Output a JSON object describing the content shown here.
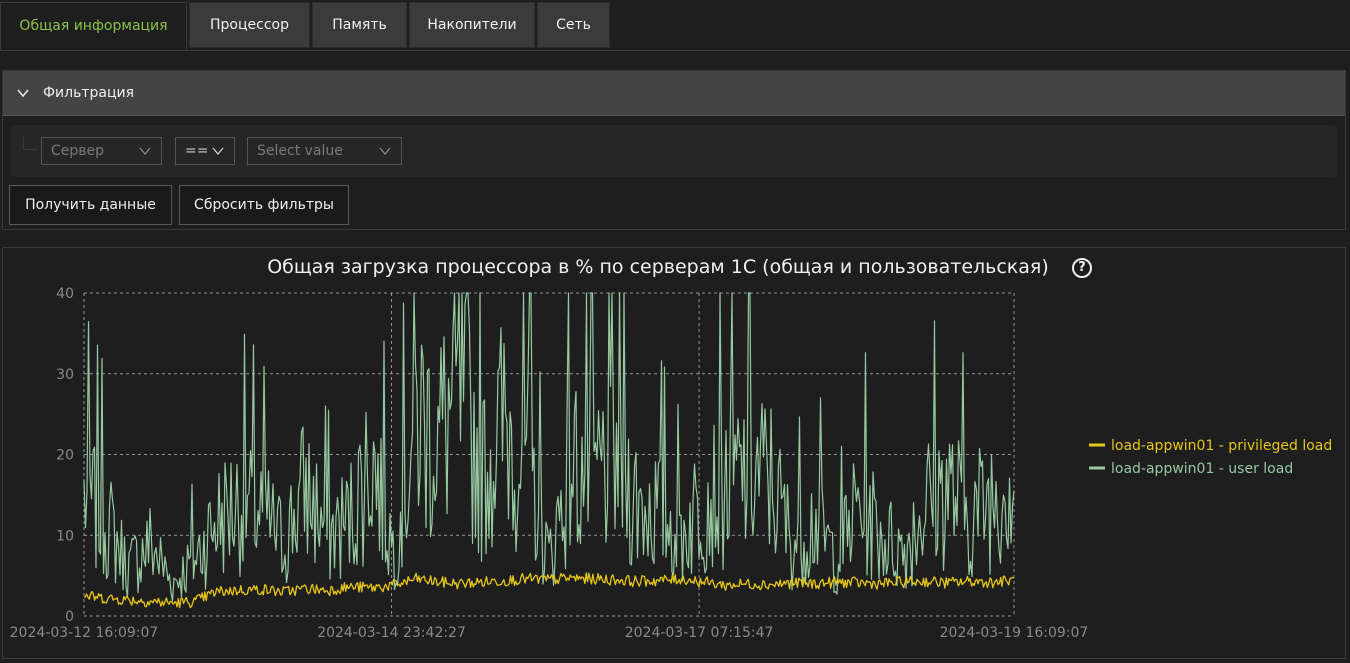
{
  "tabs": [
    {
      "label": "Общая информация",
      "active": true
    },
    {
      "label": "Процессор",
      "active": false
    },
    {
      "label": "Память",
      "active": false
    },
    {
      "label": "Накопители",
      "active": false
    },
    {
      "label": "Сеть",
      "active": false
    }
  ],
  "filter": {
    "title": "Фильтрация",
    "field_value": "Сервер",
    "operator_value": "==",
    "value_placeholder": "Select value",
    "get_data_label": "Получить данные",
    "reset_label": "Сбросить фильтры"
  },
  "colors": {
    "accent": "#8bc34a",
    "privileged": "#e6c619",
    "user": "#97c9a0"
  },
  "chart_data": {
    "type": "line",
    "title": "Общая загрузка процессора в % по серверам 1С (общая и пользовательская)",
    "help_icon": "question-circle-icon",
    "ylim": [
      0,
      40
    ],
    "yticks": [
      0,
      10,
      20,
      30,
      40
    ],
    "xlim": [
      "2024-03-12 16:09:07",
      "2024-03-19 16:09:07"
    ],
    "xticks": [
      "2024-03-12 16:09:07",
      "2024-03-14 23:42:27",
      "2024-03-17 07:15:47",
      "2024-03-19 16:09:07"
    ],
    "grid": true,
    "legend_position": "right",
    "series": [
      {
        "name": "load-appwin01 - privileged load",
        "color": "#e6c619",
        "x": [
          "2024-03-12 16:09",
          "2024-03-12 20:09",
          "2024-03-13 00:09",
          "2024-03-13 04:09",
          "2024-03-13 08:09",
          "2024-03-13 12:09",
          "2024-03-13 16:09",
          "2024-03-13 20:09",
          "2024-03-14 00:09",
          "2024-03-14 04:09",
          "2024-03-14 08:09",
          "2024-03-14 12:09",
          "2024-03-14 16:09",
          "2024-03-14 20:09",
          "2024-03-15 00:09",
          "2024-03-15 04:09",
          "2024-03-15 08:09",
          "2024-03-15 12:09",
          "2024-03-15 16:09",
          "2024-03-15 20:09",
          "2024-03-16 00:09",
          "2024-03-16 04:09",
          "2024-03-16 08:09",
          "2024-03-16 12:09",
          "2024-03-16 16:09",
          "2024-03-16 20:09",
          "2024-03-17 00:09",
          "2024-03-17 04:09",
          "2024-03-17 08:09",
          "2024-03-17 12:09",
          "2024-03-17 16:09",
          "2024-03-17 20:09",
          "2024-03-18 00:09",
          "2024-03-18 04:09",
          "2024-03-18 08:09",
          "2024-03-18 12:09",
          "2024-03-18 16:09",
          "2024-03-18 20:09",
          "2024-03-19 00:09",
          "2024-03-19 04:09",
          "2024-03-19 08:09",
          "2024-03-19 12:09",
          "2024-03-19 16:09"
        ],
        "values": [
          2.5,
          2.2,
          2.0,
          1.8,
          1.6,
          1.8,
          3.0,
          3.2,
          3.3,
          3.0,
          3.4,
          3.2,
          3.6,
          3.5,
          3.8,
          4.6,
          4.2,
          4.0,
          4.2,
          4.4,
          4.6,
          4.5,
          4.7,
          4.6,
          4.5,
          4.3,
          4.4,
          4.6,
          4.2,
          3.8,
          4.0,
          3.9,
          4.1,
          4.0,
          4.2,
          4.1,
          4.0,
          4.2,
          4.3,
          4.1,
          4.3,
          4.2,
          4.4
        ]
      },
      {
        "name": "load-appwin01 - user load",
        "color": "#97c9a0",
        "x": [
          "2024-03-12 16:09",
          "2024-03-12 20:09",
          "2024-03-13 00:09",
          "2024-03-13 04:09",
          "2024-03-13 08:09",
          "2024-03-13 12:09",
          "2024-03-13 16:09",
          "2024-03-13 20:09",
          "2024-03-14 00:09",
          "2024-03-14 04:09",
          "2024-03-14 08:09",
          "2024-03-14 12:09",
          "2024-03-14 16:09",
          "2024-03-14 20:09",
          "2024-03-15 00:09",
          "2024-03-15 04:09",
          "2024-03-15 08:09",
          "2024-03-15 12:09",
          "2024-03-15 16:09",
          "2024-03-15 20:09",
          "2024-03-16 00:09",
          "2024-03-16 04:09",
          "2024-03-16 08:09",
          "2024-03-16 12:09",
          "2024-03-16 16:09",
          "2024-03-16 20:09",
          "2024-03-17 00:09",
          "2024-03-17 04:09",
          "2024-03-17 08:09",
          "2024-03-17 12:09",
          "2024-03-17 16:09",
          "2024-03-17 20:09",
          "2024-03-18 00:09",
          "2024-03-18 04:09",
          "2024-03-18 08:09",
          "2024-03-18 12:09",
          "2024-03-18 16:09",
          "2024-03-18 20:09",
          "2024-03-19 00:09",
          "2024-03-19 04:09",
          "2024-03-19 08:09",
          "2024-03-19 12:09",
          "2024-03-19 16:09"
        ],
        "values": [
          15,
          12,
          6,
          9,
          4,
          7,
          12,
          14,
          13,
          9,
          16,
          10,
          12,
          20,
          8,
          25,
          22,
          28,
          18,
          24,
          20,
          7,
          19,
          17,
          20,
          14,
          13,
          10,
          15,
          16,
          18,
          17,
          9,
          12,
          7,
          14,
          10,
          8,
          14,
          16,
          12,
          15,
          18
        ]
      }
    ]
  }
}
